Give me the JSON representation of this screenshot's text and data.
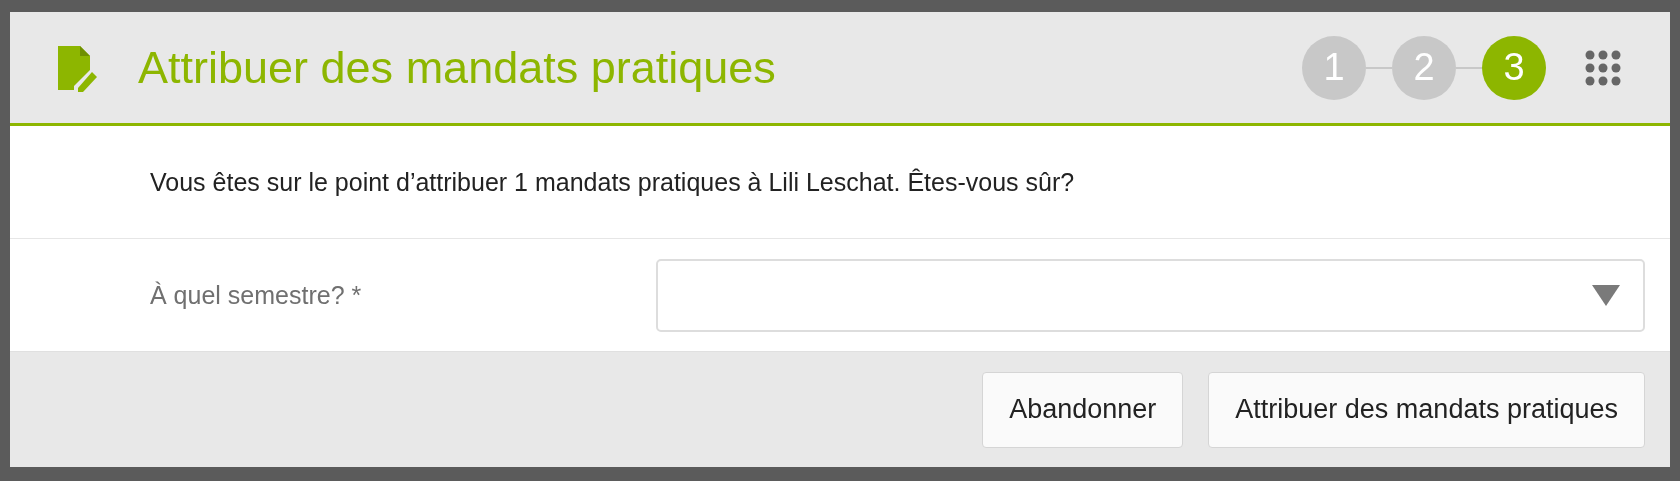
{
  "dialog": {
    "title": "Attribuer des mandats pratiques",
    "steps": [
      {
        "label": "1",
        "selected": false
      },
      {
        "label": "2",
        "selected": false
      },
      {
        "label": "3",
        "selected": true
      }
    ],
    "message": "Vous êtes sur le point d’attribuer 1 mandats pratiques à Lili Leschat. Êtes-vous sûr?",
    "field": {
      "label": "À quel semestre? *"
    },
    "buttons": [
      "Abandonner",
      "Attribuer des mandats pratiques"
    ]
  }
}
